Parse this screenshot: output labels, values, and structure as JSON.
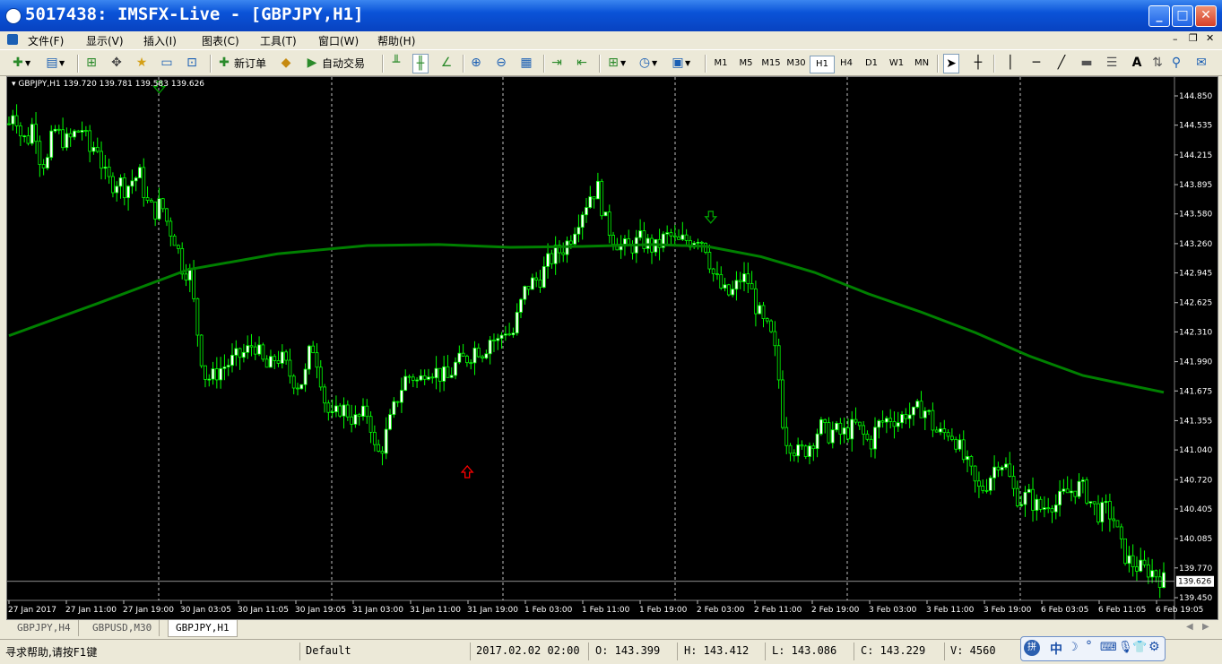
{
  "window": {
    "title": "5017438: IMSFX-Live - [GBPJPY,H1]",
    "controls": {
      "minimize": "_",
      "maximize": "□",
      "close": "✕"
    }
  },
  "menu": [
    "文件(F)",
    "显示(V)",
    "插入(I)",
    "图表(C)",
    "工具(T)",
    "窗口(W)",
    "帮助(H)"
  ],
  "toolbar": {
    "new_order": "新订单",
    "auto_trading": "自动交易",
    "timeframes": [
      "M1",
      "M5",
      "M15",
      "M30",
      "H1",
      "H4",
      "D1",
      "W1",
      "MN"
    ],
    "active_timeframe": "H1"
  },
  "chart_data": {
    "type": "candlestick",
    "header": "GBPJPY,H1  139.720 139.781 139.583 139.626",
    "symbol": "GBPJPY,H1",
    "ohlc": {
      "open": "139.720",
      "high": "139.781",
      "low": "139.583",
      "close": "139.626"
    },
    "current_price": "139.626",
    "price_ticks": [
      "144.850",
      "144.535",
      "144.215",
      "143.895",
      "143.580",
      "143.260",
      "142.945",
      "142.625",
      "142.310",
      "141.990",
      "141.675",
      "141.355",
      "141.040",
      "140.720",
      "140.405",
      "140.085",
      "139.770",
      "139.450"
    ],
    "time_labels": [
      "27 Jan 2017",
      "27 Jan 11:00",
      "27 Jan 19:00",
      "30 Jan 03:05",
      "30 Jan 11:05",
      "30 Jan 19:05",
      "31 Jan 03:00",
      "31 Jan 11:00",
      "31 Jan 19:00",
      "1 Feb 03:00",
      "1 Feb 11:00",
      "1 Feb 19:00",
      "2 Feb 03:00",
      "2 Feb 11:00",
      "2 Feb 19:00",
      "3 Feb 03:00",
      "3 Feb 11:00",
      "3 Feb 19:00",
      "6 Feb 03:05",
      "6 Feb 11:05",
      "6 Feb 19:05"
    ],
    "ylim": [
      139.45,
      144.85
    ],
    "close_path": [
      [
        0,
        144.55
      ],
      [
        6,
        144.75
      ],
      [
        12,
        144.45
      ],
      [
        20,
        144.35
      ],
      [
        28,
        144.6
      ],
      [
        34,
        144.2
      ],
      [
        42,
        144.1
      ],
      [
        50,
        144.5
      ],
      [
        58,
        144.4
      ],
      [
        66,
        144.35
      ],
      [
        74,
        144.45
      ],
      [
        82,
        144.5
      ],
      [
        90,
        144.25
      ],
      [
        98,
        144.35
      ],
      [
        106,
        144.0
      ],
      [
        114,
        143.9
      ],
      [
        122,
        143.95
      ],
      [
        130,
        143.85
      ],
      [
        138,
        143.95
      ],
      [
        146,
        144.0
      ],
      [
        154,
        143.7
      ],
      [
        162,
        143.6
      ],
      [
        170,
        143.7
      ],
      [
        178,
        143.45
      ],
      [
        186,
        143.3
      ],
      [
        194,
        143.0
      ],
      [
        202,
        142.95
      ],
      [
        210,
        142.35
      ],
      [
        218,
        141.85
      ],
      [
        226,
        141.8
      ],
      [
        234,
        141.9
      ],
      [
        242,
        141.95
      ],
      [
        250,
        142.0
      ],
      [
        258,
        142.05
      ],
      [
        266,
        142.1
      ],
      [
        274,
        142.2
      ],
      [
        282,
        142.0
      ],
      [
        290,
        141.9
      ],
      [
        298,
        142.05
      ],
      [
        306,
        142.0
      ],
      [
        314,
        141.85
      ],
      [
        322,
        141.75
      ],
      [
        330,
        141.8
      ],
      [
        338,
        142.2
      ],
      [
        346,
        141.95
      ],
      [
        354,
        141.5
      ],
      [
        362,
        141.35
      ],
      [
        370,
        141.5
      ],
      [
        378,
        141.45
      ],
      [
        386,
        141.35
      ],
      [
        394,
        141.4
      ],
      [
        402,
        141.45
      ],
      [
        410,
        140.95
      ],
      [
        418,
        141.1
      ],
      [
        426,
        141.35
      ],
      [
        434,
        141.6
      ],
      [
        442,
        141.8
      ],
      [
        450,
        141.85
      ],
      [
        458,
        141.75
      ],
      [
        466,
        141.95
      ],
      [
        474,
        141.9
      ],
      [
        482,
        141.85
      ],
      [
        490,
        141.8
      ],
      [
        498,
        141.95
      ],
      [
        506,
        142.0
      ],
      [
        514,
        142.05
      ],
      [
        522,
        142.15
      ],
      [
        530,
        142.1
      ],
      [
        538,
        142.25
      ],
      [
        546,
        142.2
      ],
      [
        554,
        142.35
      ],
      [
        562,
        142.25
      ],
      [
        570,
        142.55
      ],
      [
        578,
        142.8
      ],
      [
        586,
        142.85
      ],
      [
        594,
        142.9
      ],
      [
        602,
        143.05
      ],
      [
        610,
        143.15
      ],
      [
        618,
        143.2
      ],
      [
        626,
        143.3
      ],
      [
        634,
        143.5
      ],
      [
        642,
        143.65
      ],
      [
        650,
        143.8
      ],
      [
        658,
        143.85
      ],
      [
        666,
        143.5
      ],
      [
        674,
        143.35
      ],
      [
        682,
        143.25
      ],
      [
        690,
        143.2
      ],
      [
        698,
        143.25
      ],
      [
        706,
        143.3
      ],
      [
        714,
        143.25
      ],
      [
        722,
        143.2
      ],
      [
        730,
        143.3
      ],
      [
        738,
        143.35
      ],
      [
        746,
        143.25
      ],
      [
        754,
        143.3
      ],
      [
        762,
        143.3
      ],
      [
        770,
        143.35
      ],
      [
        778,
        143.25
      ],
      [
        786,
        142.95
      ],
      [
        794,
        142.8
      ],
      [
        802,
        142.7
      ],
      [
        810,
        142.75
      ],
      [
        818,
        142.9
      ],
      [
        826,
        142.85
      ],
      [
        834,
        142.6
      ],
      [
        842,
        142.4
      ],
      [
        850,
        142.3
      ],
      [
        858,
        142.0
      ],
      [
        866,
        141.2
      ],
      [
        874,
        141.1
      ],
      [
        882,
        141.0
      ],
      [
        890,
        141.05
      ],
      [
        898,
        141.15
      ],
      [
        906,
        141.3
      ],
      [
        914,
        141.2
      ],
      [
        922,
        141.25
      ],
      [
        930,
        141.2
      ],
      [
        938,
        141.25
      ],
      [
        946,
        141.3
      ],
      [
        954,
        141.2
      ],
      [
        962,
        141.1
      ],
      [
        970,
        141.3
      ],
      [
        978,
        141.35
      ],
      [
        986,
        141.4
      ],
      [
        994,
        141.35
      ],
      [
        1002,
        141.45
      ],
      [
        1010,
        141.4
      ],
      [
        1018,
        141.5
      ],
      [
        1026,
        141.45
      ],
      [
        1034,
        141.25
      ],
      [
        1042,
        141.2
      ],
      [
        1050,
        141.25
      ],
      [
        1058,
        141.15
      ],
      [
        1066,
        140.95
      ],
      [
        1074,
        140.8
      ],
      [
        1082,
        140.6
      ],
      [
        1090,
        140.65
      ],
      [
        1098,
        140.8
      ],
      [
        1106,
        140.95
      ],
      [
        1114,
        140.85
      ],
      [
        1122,
        140.6
      ],
      [
        1130,
        140.5
      ],
      [
        1138,
        140.55
      ],
      [
        1146,
        140.45
      ],
      [
        1154,
        140.4
      ],
      [
        1162,
        140.5
      ],
      [
        1170,
        140.45
      ],
      [
        1178,
        140.55
      ],
      [
        1186,
        140.6
      ],
      [
        1194,
        140.65
      ],
      [
        1202,
        140.6
      ],
      [
        1210,
        140.45
      ],
      [
        1218,
        140.35
      ],
      [
        1226,
        140.4
      ],
      [
        1234,
        140.3
      ],
      [
        1242,
        140.0
      ],
      [
        1250,
        139.85
      ],
      [
        1258,
        139.8
      ],
      [
        1266,
        139.75
      ],
      [
        1274,
        139.75
      ],
      [
        1282,
        139.7
      ],
      [
        1290,
        139.63
      ]
    ],
    "ma_line": [
      [
        0,
        142.27
      ],
      [
        100,
        142.62
      ],
      [
        200,
        142.98
      ],
      [
        300,
        143.15
      ],
      [
        400,
        143.24
      ],
      [
        480,
        143.25
      ],
      [
        560,
        143.22
      ],
      [
        640,
        143.23
      ],
      [
        720,
        143.25
      ],
      [
        780,
        143.23
      ],
      [
        840,
        143.12
      ],
      [
        900,
        142.95
      ],
      [
        960,
        142.72
      ],
      [
        1020,
        142.52
      ],
      [
        1080,
        142.3
      ],
      [
        1140,
        142.05
      ],
      [
        1200,
        141.84
      ],
      [
        1260,
        141.72
      ],
      [
        1290,
        141.66
      ]
    ],
    "arrows": [
      {
        "type": "sell",
        "t": 168,
        "price": 144.95
      },
      {
        "type": "buy",
        "t": 512,
        "price": 140.8
      },
      {
        "type": "sell",
        "t": 784,
        "price": 143.55
      }
    ],
    "grid": "vertical day separators"
  },
  "tabs": [
    "GBPJPY,H4",
    "GBPUSD,M30",
    "GBPJPY,H1"
  ],
  "active_tab": "GBPJPY,H1",
  "status": {
    "help": "寻求帮助,请按F1键",
    "profile": "Default",
    "datetime": "2017.02.02 02:00",
    "open": "O: 143.399",
    "high": "H: 143.412",
    "low": "L: 143.086",
    "close": "C: 143.229",
    "volume": "V: 4560"
  },
  "ime": {
    "label": "中",
    "icons": [
      "moon-icon",
      "comma-icon",
      "keyboard-icon",
      "mic-icon",
      "shirt-icon",
      "gear-icon"
    ]
  },
  "colors": {
    "bull": "#ffffff",
    "bear": "#000000",
    "wick": "#00ff00",
    "ma": "#008000",
    "buy_arrow": "#ff0000",
    "sell_arrow": "#00a000",
    "background": "#000000"
  }
}
